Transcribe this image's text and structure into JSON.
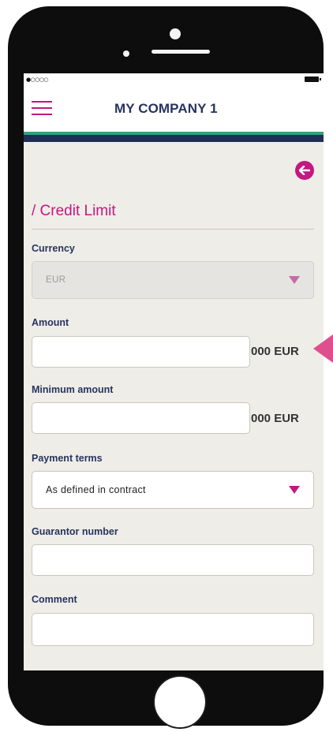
{
  "app": {
    "title": "MY COMPANY 1",
    "signal_text": "●○○○○",
    "accent_color": "#c2187f",
    "header_text_color": "#27345e",
    "stripe_green": "#2fa37b",
    "stripe_navy": "#1f2d57"
  },
  "icons": {
    "menu": "hamburger-menu-icon",
    "back": "back-arrow-icon",
    "dropdown": "caret-down-icon"
  },
  "form": {
    "title": "/ Credit Limit",
    "currency": {
      "label": "Currency",
      "value": "EUR"
    },
    "amount": {
      "label": "Amount",
      "value": "",
      "suffix": "000 EUR"
    },
    "minimum_amount": {
      "label": "Minimum amount",
      "value": "",
      "suffix": "000 EUR"
    },
    "payment_terms": {
      "label": "Payment terms",
      "value": "As defined in contract"
    },
    "guarantor_number": {
      "label": "Guarantor number",
      "value": ""
    },
    "comment": {
      "label": "Comment",
      "value": ""
    }
  }
}
